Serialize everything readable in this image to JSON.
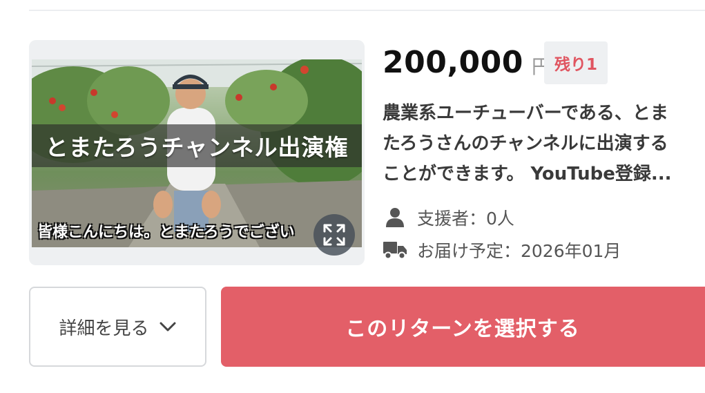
{
  "reward": {
    "video": {
      "overlay_title": "とまたろうチャンネル出演権",
      "subtitle": "皆様こんにちは。とまたろうでござい"
    },
    "price": "200,000",
    "currency": "円",
    "remaining_badge": "残り1",
    "description_lines": [
      "農業系ユーチューバーである、とま",
      "たろうさんのチャンネルに出演する",
      "ことができます。 YouTube登録..."
    ],
    "supporters": "支援者：0人",
    "delivery": "お届け予定：2026年01月",
    "details_label": "詳細を見る",
    "select_label": "このリターンを選択する"
  },
  "icons": {
    "fullscreen": "fullscreen-icon",
    "person": "person-icon",
    "truck": "truck-icon",
    "chevron": "chevron-down-icon"
  },
  "colors": {
    "accent": "#e35f68",
    "badge_text": "#e05560",
    "badge_bg": "#eef0f2"
  }
}
